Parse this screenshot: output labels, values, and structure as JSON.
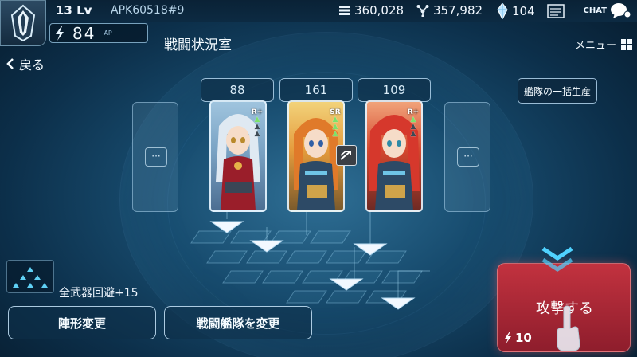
{
  "header": {
    "level": "13 Lv",
    "player_id": "APK60518#9",
    "fuel": "360,028",
    "metal": "357,982",
    "crystal": "104",
    "chat_label": "CHAT"
  },
  "ap": {
    "value": "84",
    "unit": "AP"
  },
  "screen_title": "戦闘状況室",
  "nav": {
    "back_label": "戻る",
    "menu_label": "メニュー"
  },
  "fleet": {
    "bulk_produce_label": "艦隊の一括生産",
    "powers": [
      "88",
      "161",
      "109"
    ],
    "units": [
      {
        "rank": "R+",
        "stars": 1
      },
      {
        "rank": "SR",
        "stars": 3
      },
      {
        "rank": "R+",
        "stars": 1
      }
    ],
    "empty_slot_label": "···"
  },
  "formation": {
    "bonus_text": "全武器回避+15"
  },
  "buttons": {
    "formation_change": "陣形変更",
    "fleet_change": "戦闘艦隊を変更",
    "attack": "攻撃する",
    "attack_cost": "10"
  },
  "colors": {
    "accent": "#c2323f",
    "star_on": "#7be36a"
  }
}
